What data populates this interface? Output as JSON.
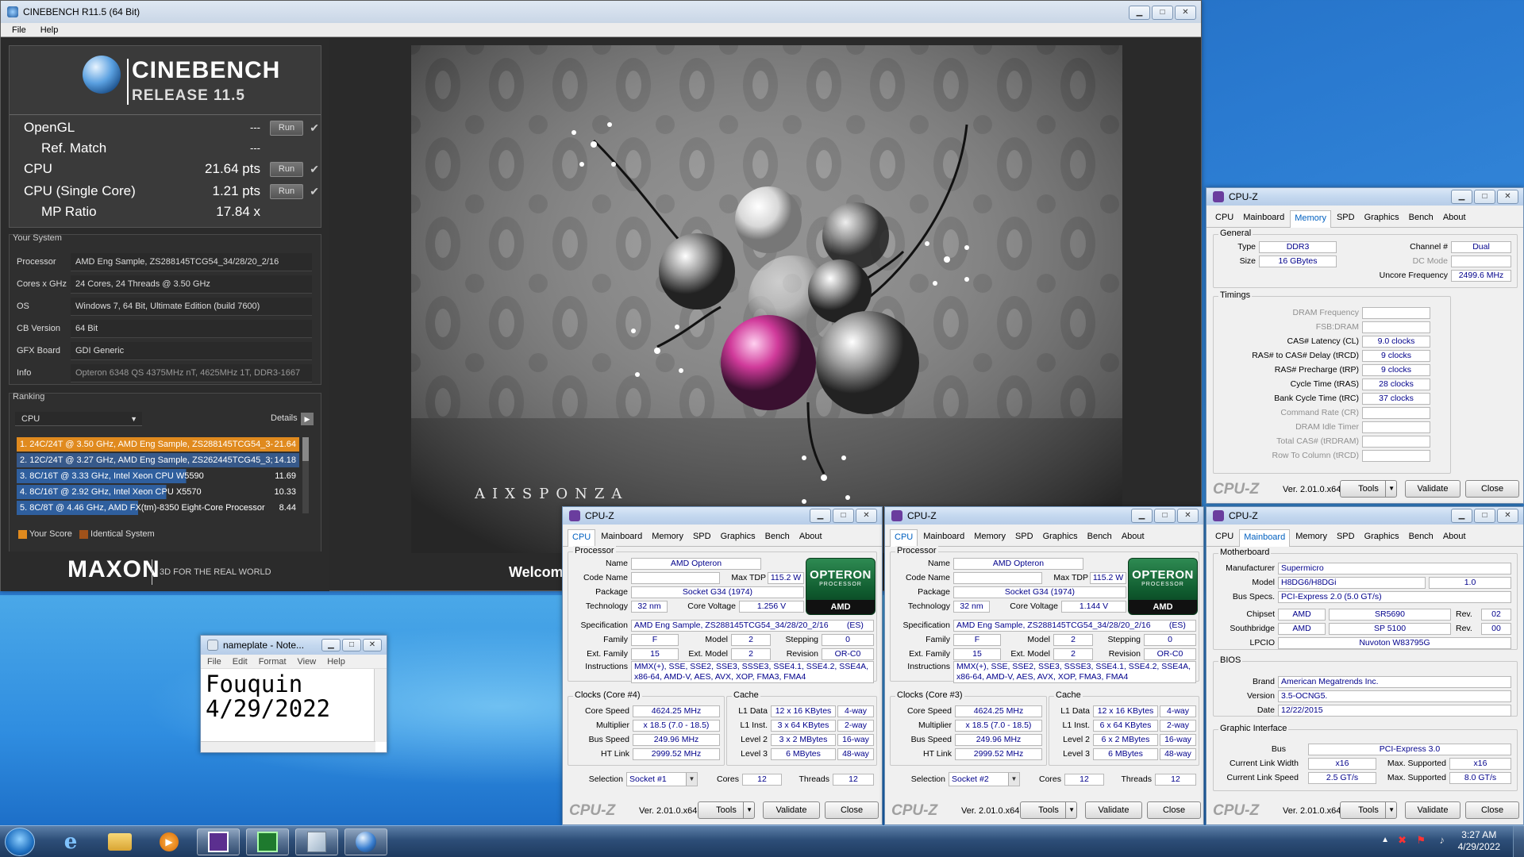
{
  "cinebench": {
    "title": "CINEBENCH R11.5 (64 Bit)",
    "menu": [
      "File",
      "Help"
    ],
    "logo": {
      "name": "CINEBENCH",
      "release": "RELEASE 11.5"
    },
    "scores": [
      {
        "label": "OpenGL",
        "value": "---",
        "run": "Run"
      },
      {
        "label": "Ref. Match",
        "value": "---",
        "run": ""
      },
      {
        "label": "CPU",
        "value": "21.64 pts",
        "run": "Run"
      },
      {
        "label": "CPU (Single Core)",
        "value": "1.21 pts",
        "run": "Run"
      },
      {
        "label": "MP Ratio",
        "value": "17.84 x",
        "run": ""
      }
    ],
    "your_system_header": "Your System",
    "system": [
      {
        "k": "Processor",
        "v": "AMD Eng Sample, ZS288145TCG54_34/28/20_2/16"
      },
      {
        "k": "Cores x GHz",
        "v": "24 Cores, 24 Threads @ 3.50 GHz"
      },
      {
        "k": "OS",
        "v": "Windows 7, 64 Bit, Ultimate Edition (build 7600)"
      },
      {
        "k": "CB Version",
        "v": "64 Bit"
      },
      {
        "k": "GFX Board",
        "v": "GDI Generic"
      },
      {
        "k": "Info",
        "v": "Opteron 6348 QS 4375MHz nT, 4625MHz 1T, DDR3-1667"
      }
    ],
    "ranking_header": "Ranking",
    "ranking_select": "CPU",
    "details": "Details",
    "ranking": [
      {
        "t": "1. 24C/24T @ 3.50 GHz, AMD Eng Sample, ZS288145TCG54_3-",
        "v": "21.64",
        "color": "#e08a1e"
      },
      {
        "t": "2. 12C/24T @ 3.27 GHz, AMD Eng Sample, ZS262445TCG45_3;",
        "v": "14.18",
        "color": "#2f5f9e"
      },
      {
        "t": "3. 8C/16T @ 3.33 GHz, Intel Xeon CPU W5590",
        "v": "11.69",
        "color": "#2f5f9e"
      },
      {
        "t": "4. 8C/16T @ 2.92 GHz, Intel Xeon CPU X5570",
        "v": "10.33",
        "color": "#2f5f9e"
      },
      {
        "t": "5. 8C/8T @ 4.46 GHz, AMD FX(tm)-8350 Eight-Core Processor",
        "v": "8.44",
        "color": "#2f5f9e"
      }
    ],
    "legend": {
      "your_score": "Your Score",
      "identical": "Identical System"
    },
    "maxon": "MAXON",
    "maxon_tag": "3D FOR THE REAL WORLD",
    "render_brand": "AIXSPONZA",
    "welcome": "Welcom"
  },
  "cpuz_memory": {
    "title": "CPU-Z",
    "tabs": [
      "CPU",
      "Mainboard",
      "Memory",
      "SPD",
      "Graphics",
      "Bench",
      "About"
    ],
    "general": "General",
    "type_l": "Type",
    "type_v": "DDR3",
    "size_l": "Size",
    "size_v": "16 GBytes",
    "channel_l": "Channel #",
    "channel_v": "Dual",
    "dcmode_l": "DC Mode",
    "uncore_l": "Uncore Frequency",
    "uncore_v": "2499.6 MHz",
    "timings": "Timings",
    "t_rows": [
      {
        "l": "DRAM Frequency",
        "v": "",
        "dim": true
      },
      {
        "l": "FSB:DRAM",
        "v": "",
        "dim": true
      },
      {
        "l": "CAS# Latency (CL)",
        "v": "9.0 clocks",
        "dim": false
      },
      {
        "l": "RAS# to CAS# Delay (tRCD)",
        "v": "9 clocks",
        "dim": false
      },
      {
        "l": "RAS# Precharge (tRP)",
        "v": "9 clocks",
        "dim": false
      },
      {
        "l": "Cycle Time (tRAS)",
        "v": "28 clocks",
        "dim": false
      },
      {
        "l": "Bank Cycle Time (tRC)",
        "v": "37 clocks",
        "dim": false
      },
      {
        "l": "Command Rate (CR)",
        "v": "",
        "dim": true
      },
      {
        "l": "DRAM Idle Timer",
        "v": "",
        "dim": true
      },
      {
        "l": "Total CAS# (tRDRAM)",
        "v": "",
        "dim": true
      },
      {
        "l": "Row To Column (tRCD)",
        "v": "",
        "dim": true
      }
    ],
    "logo": "CPU-Z",
    "version": "Ver. 2.01.0.x64",
    "tools": "Tools",
    "validate": "Validate",
    "close": "Close"
  },
  "cpuz_cpu": [
    {
      "title": "CPU-Z",
      "processor": "Processor",
      "name_l": "Name",
      "name_v": "AMD Opteron",
      "codename_l": "Code Name",
      "maxtdp_l": "Max TDP",
      "maxtdp_v": "115.2 W",
      "package_l": "Package",
      "package_v": "Socket G34 (1974)",
      "tech_l": "Technology",
      "tech_v": "32 nm",
      "cv_l": "Core Voltage",
      "cv_v": "1.256 V",
      "spec_l": "Specification",
      "spec_v": "AMD Eng Sample, ZS288145TCG54_34/28/20_2/16        (ES)",
      "family_l": "Family",
      "family_v": "F",
      "model_l": "Model",
      "model_v": "2",
      "stepping_l": "Stepping",
      "stepping_v": "0",
      "extfam_l": "Ext. Family",
      "extfam_v": "15",
      "extmodel_l": "Ext. Model",
      "extmodel_v": "2",
      "rev_l": "Revision",
      "rev_v": "OR-C0",
      "instr_l": "Instructions",
      "instr_v1": "MMX(+), SSE, SSE2, SSE3, SSSE3, SSE4.1, SSE4.2, SSE4A,",
      "instr_v2": "x86-64, AMD-V, AES, AVX, XOP, FMA3, FMA4",
      "clocks": "Clocks (Core #4)",
      "cs_l": "Core Speed",
      "cs_v": "4624.25 MHz",
      "mult_l": "Multiplier",
      "mult_v": "x 18.5 (7.0 - 18.5)",
      "bus_l": "Bus Speed",
      "bus_v": "249.96 MHz",
      "ht_l": "HT Link",
      "ht_v": "2999.52 MHz",
      "cache": "Cache",
      "l1d_l": "L1 Data",
      "l1d_v": "12 x 16 KBytes",
      "l1d_w": "4-way",
      "l1i_l": "L1 Inst.",
      "l1i_v": "3 x 64 KBytes",
      "l1i_w": "2-way",
      "l2_l": "Level 2",
      "l2_v": "3 x 2 MBytes",
      "l2_w": "16-way",
      "l3_l": "Level 3",
      "l3_v": "6 MBytes",
      "l3_w": "48-way",
      "sel_l": "Selection",
      "sel_v": "Socket #1",
      "cores_l": "Cores",
      "cores_v": "12",
      "threads_l": "Threads",
      "threads_v": "12",
      "logo": "CPU-Z",
      "version": "Ver. 2.01.0.x64",
      "tools": "Tools",
      "validate": "Validate",
      "close": "Close"
    },
    {
      "title": "CPU-Z",
      "processor": "Processor",
      "name_l": "Name",
      "name_v": "AMD Opteron",
      "codename_l": "Code Name",
      "maxtdp_l": "Max TDP",
      "maxtdp_v": "115.2 W",
      "package_l": "Package",
      "package_v": "Socket G34 (1974)",
      "tech_l": "Technology",
      "tech_v": "32 nm",
      "cv_l": "Core Voltage",
      "cv_v": "1.144 V",
      "spec_l": "Specification",
      "spec_v": "AMD Eng Sample, ZS288145TCG54_34/28/20_2/16        (ES)",
      "family_l": "Family",
      "family_v": "F",
      "model_l": "Model",
      "model_v": "2",
      "stepping_l": "Stepping",
      "stepping_v": "0",
      "extfam_l": "Ext. Family",
      "extfam_v": "15",
      "extmodel_l": "Ext. Model",
      "extmodel_v": "2",
      "rev_l": "Revision",
      "rev_v": "OR-C0",
      "instr_l": "Instructions",
      "instr_v1": "MMX(+), SSE, SSE2, SSE3, SSSE3, SSE4.1, SSE4.2, SSE4A,",
      "instr_v2": "x86-64, AMD-V, AES, AVX, XOP, FMA3, FMA4",
      "clocks": "Clocks (Core #3)",
      "cs_l": "Core Speed",
      "cs_v": "4624.25 MHz",
      "mult_l": "Multiplier",
      "mult_v": "x 18.5 (7.0 - 18.5)",
      "bus_l": "Bus Speed",
      "bus_v": "249.96 MHz",
      "ht_l": "HT Link",
      "ht_v": "2999.52 MHz",
      "cache": "Cache",
      "l1d_l": "L1 Data",
      "l1d_v": "12 x 16 KBytes",
      "l1d_w": "4-way",
      "l1i_l": "L1 Inst.",
      "l1i_v": "6 x 64 KBytes",
      "l1i_w": "2-way",
      "l2_l": "Level 2",
      "l2_v": "6 x 2 MBytes",
      "l2_w": "16-way",
      "l3_l": "Level 3",
      "l3_v": "6 MBytes",
      "l3_w": "48-way",
      "sel_l": "Selection",
      "sel_v": "Socket #2",
      "cores_l": "Cores",
      "cores_v": "12",
      "threads_l": "Threads",
      "threads_v": "12",
      "logo": "CPU-Z",
      "version": "Ver. 2.01.0.x64",
      "tools": "Tools",
      "validate": "Validate",
      "close": "Close"
    }
  ],
  "cpu_tabs": [
    "CPU",
    "Mainboard",
    "Memory",
    "SPD",
    "Graphics",
    "Bench",
    "About"
  ],
  "amd": {
    "line1": "OPTERON",
    "line2": "PROCESSOR",
    "line3": "AMD"
  },
  "cpuz_mainboard": {
    "title": "CPU-Z",
    "tabs": [
      "CPU",
      "Mainboard",
      "Memory",
      "SPD",
      "Graphics",
      "Bench",
      "About"
    ],
    "motherboard": "Motherboard",
    "mfr_l": "Manufacturer",
    "mfr_v": "Supermicro",
    "model_l": "Model",
    "model_v": "H8DG6/H8DGi",
    "model_rev": "1.0",
    "busspec_l": "Bus Specs.",
    "busspec_v": "PCI-Express 2.0 (5.0 GT/s)",
    "chipset_l": "Chipset",
    "chipset_v1": "AMD",
    "chipset_v2": "SR5690",
    "rev_l": "Rev.",
    "chipset_rev": "02",
    "sb_l": "Southbridge",
    "sb_v1": "AMD",
    "sb_v2": "SP 5100",
    "sb_rev": "00",
    "lpcio_l": "LPCIO",
    "lpcio_v": "Nuvoton W83795G",
    "bios": "BIOS",
    "brand_l": "Brand",
    "brand_v": "American Megatrends Inc.",
    "version_l": "Version",
    "version_v": "3.5-OCNG5.",
    "date_l": "Date",
    "date_v": "12/22/2015",
    "gi": "Graphic Interface",
    "bus_l": "Bus",
    "bus_v": "PCI-Express 3.0",
    "clw_l": "Current Link Width",
    "clw_v": "x16",
    "maxs_l": "Max. Supported",
    "mlw_v": "x16",
    "cls_l": "Current Link Speed",
    "cls_v": "2.5 GT/s",
    "mls_v": "8.0 GT/s",
    "logo": "CPU-Z",
    "version": "Ver. 2.01.0.x64",
    "tools": "Tools",
    "validate": "Validate",
    "close": "Close"
  },
  "notepad": {
    "title": "nameplate - Note...",
    "menu": [
      "File",
      "Edit",
      "Format",
      "View",
      "Help"
    ],
    "line1": "Fouquin",
    "line2": "4/29/2022"
  },
  "taskbar": {
    "time": "3:27 AM",
    "date": "4/29/2022"
  }
}
